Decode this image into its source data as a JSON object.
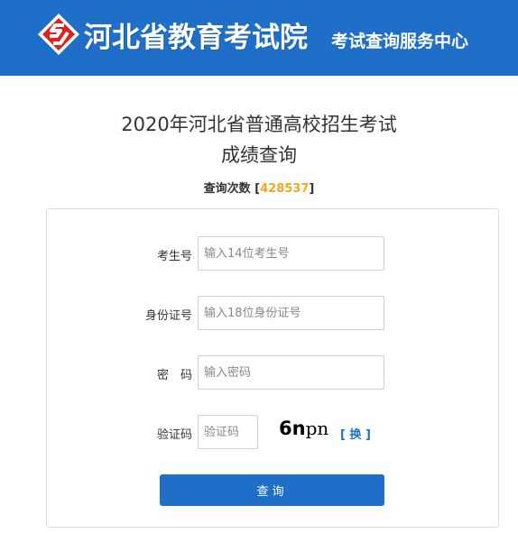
{
  "header": {
    "site_name": "河北省教育考试院",
    "site_subtitle": "考试查询服务中心",
    "brand_color": "#1f6fc8",
    "logo_color": "#e0211b"
  },
  "page": {
    "title_line1": "2020年河北省普通高校招生考试",
    "title_line2": "成绩查询"
  },
  "counter": {
    "label": "查询次数",
    "open_bracket": "[",
    "value": "428537",
    "close_bracket": "]",
    "value_color": "#f5a623"
  },
  "form": {
    "exam_no": {
      "label": "考生号",
      "placeholder": "输入14位考生号",
      "value": ""
    },
    "id_no": {
      "label": "身份证号",
      "placeholder": "输入18位身份证号",
      "value": ""
    },
    "password": {
      "label": "密　码",
      "placeholder": "输入密码",
      "value": ""
    },
    "captcha": {
      "label": "验证码",
      "placeholder": "验证码",
      "value": "",
      "image_text_a": "6n",
      "image_text_b": "pn",
      "change_label": "[ 换 ]"
    },
    "submit_label": "查询"
  }
}
